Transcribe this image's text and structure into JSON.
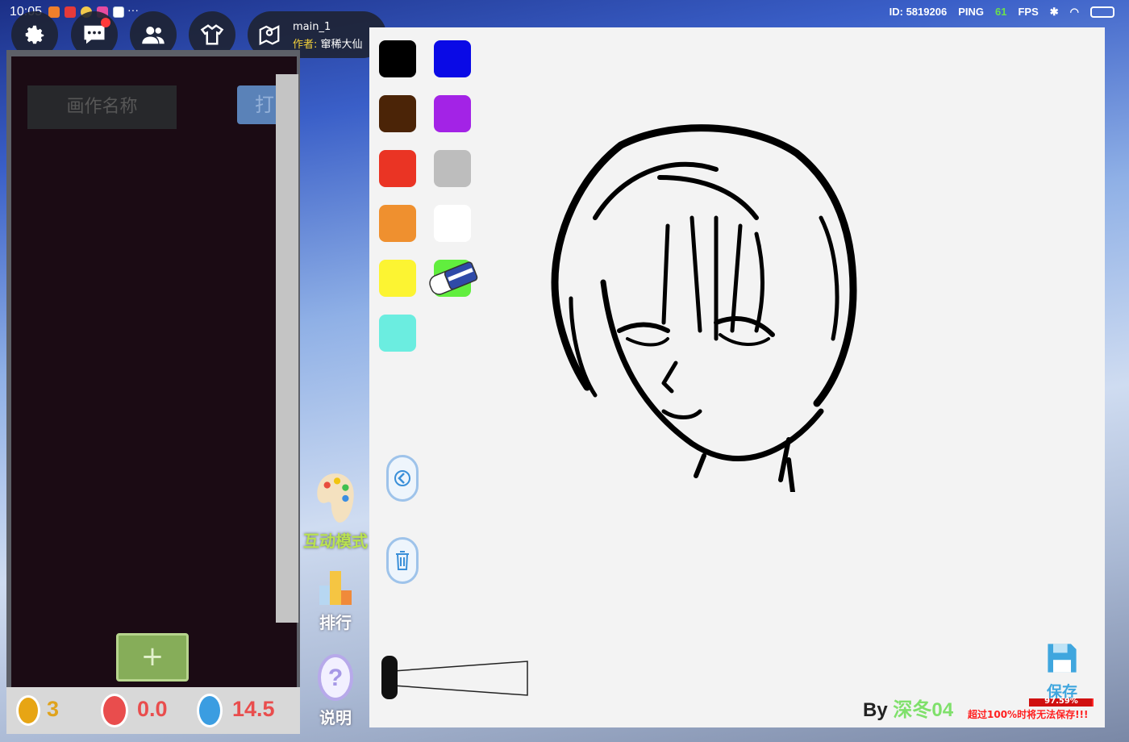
{
  "status_bar": {
    "time": "10:05",
    "more_dots": "···",
    "id_text": "ID: 5819206",
    "ping_label": "PING",
    "ping_value": "61",
    "fps_label": "FPS"
  },
  "top_buttons": [
    {
      "icon": "gear-icon"
    },
    {
      "icon": "chat-icon"
    },
    {
      "icon": "friends-icon"
    },
    {
      "icon": "wardrobe-icon"
    }
  ],
  "map_info": {
    "name": "main_1",
    "author_label": "作者:",
    "author_name": "窜稀大仙"
  },
  "left_panel": {
    "work_name_placeholder": "画作名称",
    "print_label": "打",
    "add_label": "+",
    "stats": {
      "coins": "3",
      "likes": "0.0",
      "alerts": "14.5"
    }
  },
  "middle_tools": [
    {
      "icon": "palette-icon",
      "label": "互动模式",
      "label_color": "#b9e24f"
    },
    {
      "icon": "podium-icon",
      "label": "排行"
    },
    {
      "icon": "question-icon",
      "label": "说明"
    }
  ],
  "palette": {
    "colors": [
      "#000000",
      "#0a0ae6",
      "#4b2407",
      "#a323e6",
      "#ea3424",
      "#bdbdbd",
      "#ef902f",
      "#ffffff",
      "#fcf432",
      "#61ee3e",
      "#6bede0"
    ],
    "tools": [
      "eraser-icon",
      "undo-icon",
      "trash-icon",
      "brush-size-slider"
    ]
  },
  "footer": {
    "by_label": "By",
    "artist": "深冬04",
    "save_label": "保存",
    "progress_text": "97.59%",
    "progress_value": 0.9759,
    "warning": "超过100%时将无法保存!!!"
  }
}
